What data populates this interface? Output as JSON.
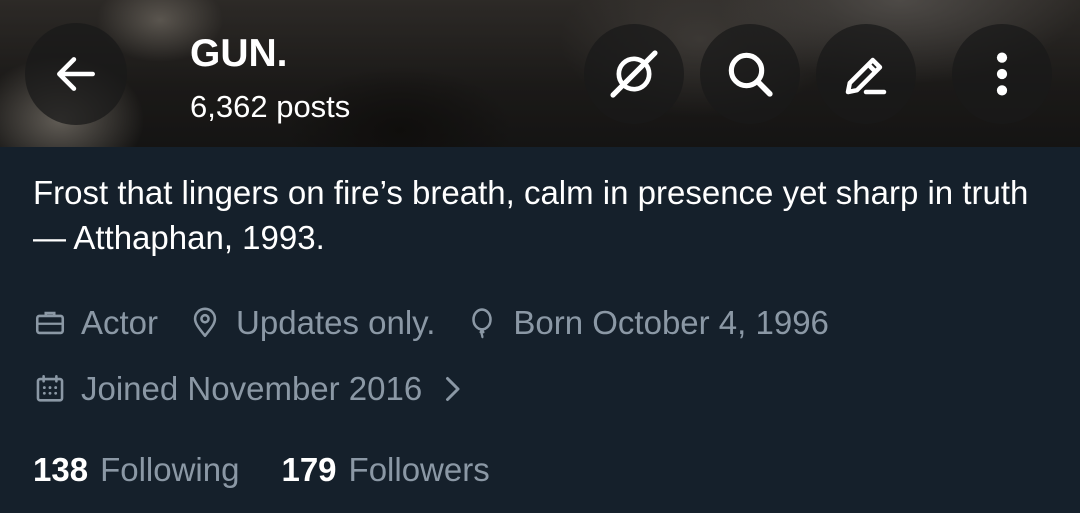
{
  "header": {
    "title": "GUN.",
    "posts_count": "6,362",
    "posts_label": "posts",
    "icons": {
      "back": "back-arrow-icon",
      "grok": "grok-icon",
      "search": "search-icon",
      "edit": "edit-pen-icon",
      "more": "more-vertical-icon"
    }
  },
  "bio": {
    "text": "Frost that lingers on fire’s breath, calm in presence yet sharp in truth — Atthaphan, 1993."
  },
  "meta": {
    "category": "Actor",
    "location": "Updates only.",
    "birthday": "Born October 4, 1996",
    "joined": "Joined November 2016",
    "icons": {
      "category": "briefcase-icon",
      "location": "location-pin-icon",
      "birthday": "balloon-icon",
      "joined": "calendar-icon",
      "chevron": "chevron-right-icon"
    }
  },
  "stats": {
    "following_count": "138",
    "following_label": "Following",
    "followers_count": "179",
    "followers_label": "Followers"
  },
  "colors": {
    "background": "#15202b",
    "primary_text": "#ffffff",
    "secondary_text": "#8b98a5"
  }
}
